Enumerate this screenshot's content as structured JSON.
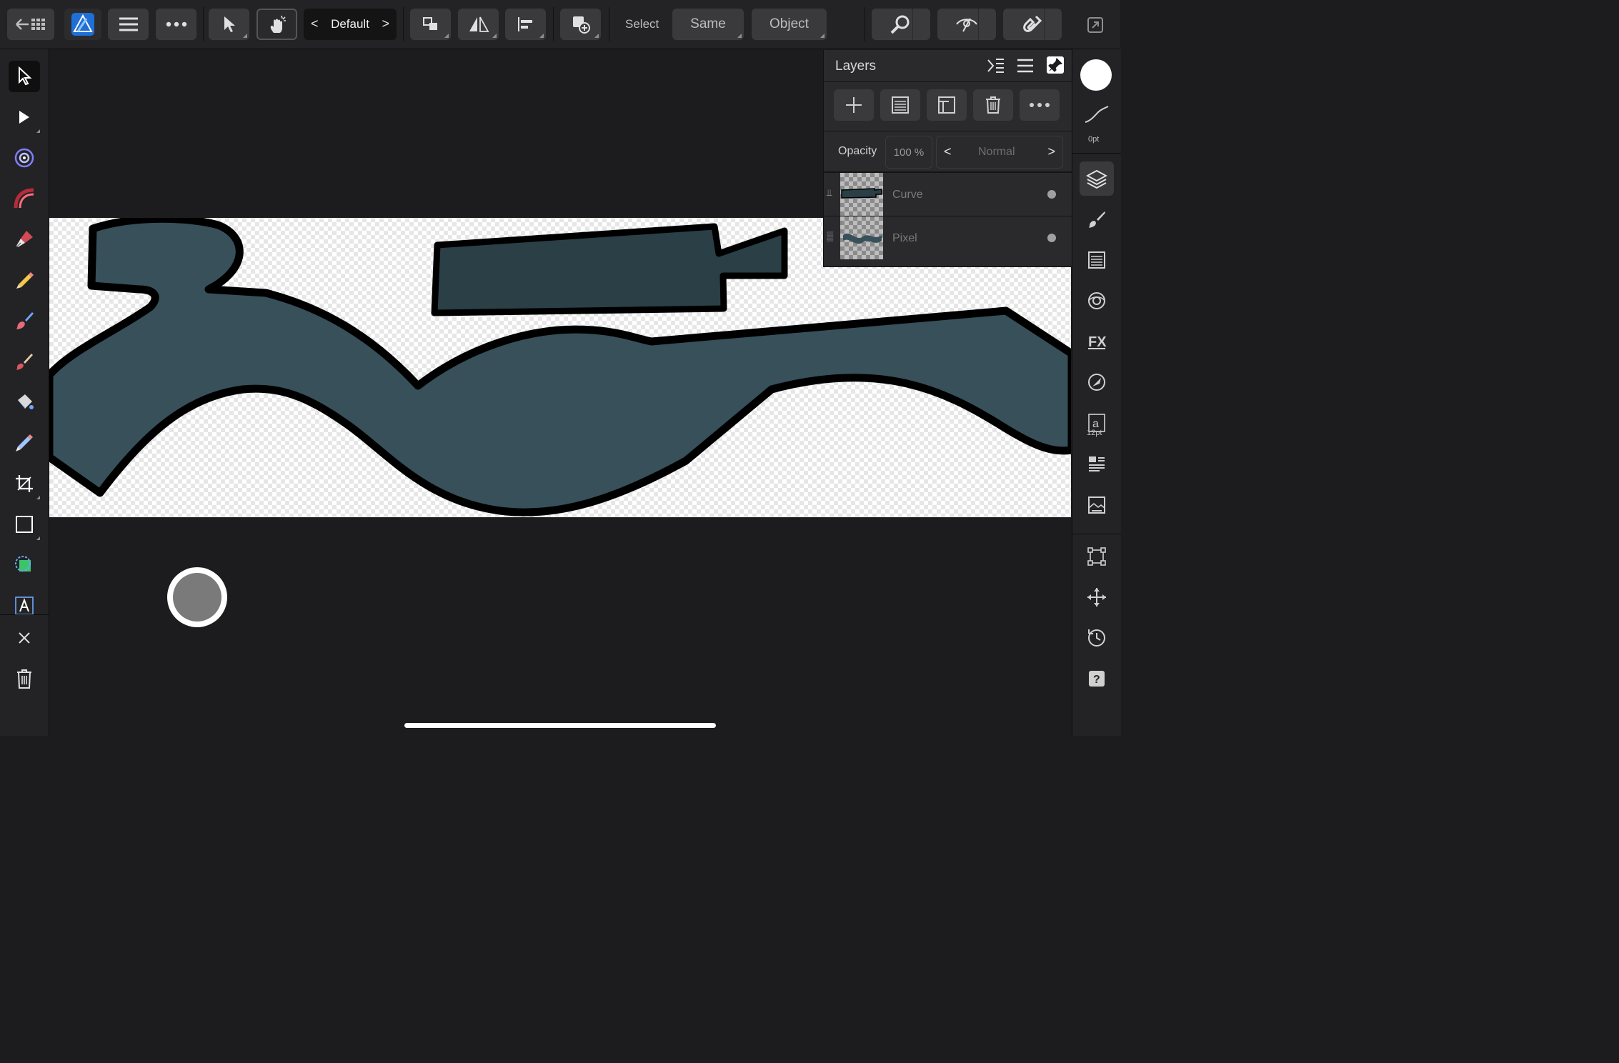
{
  "toolbar": {
    "persona_label": "Default",
    "select_label": "Select",
    "same_label": "Same",
    "object_label": "Object"
  },
  "layers_panel": {
    "title": "Layers",
    "opacity_label": "Opacity",
    "opacity_value": "100 %",
    "blend_mode": "Normal",
    "layers": [
      {
        "name": "Curve",
        "type_icon": "vector-icon"
      },
      {
        "name": "Pixel",
        "type_icon": "pixel-icon"
      }
    ]
  },
  "context_studio": {
    "stroke_width": "0pt",
    "font_size": "12pt"
  },
  "colors": {
    "shape_fill": "#37505a",
    "shape_stroke": "#000000",
    "accent": "#1f6fd6"
  }
}
